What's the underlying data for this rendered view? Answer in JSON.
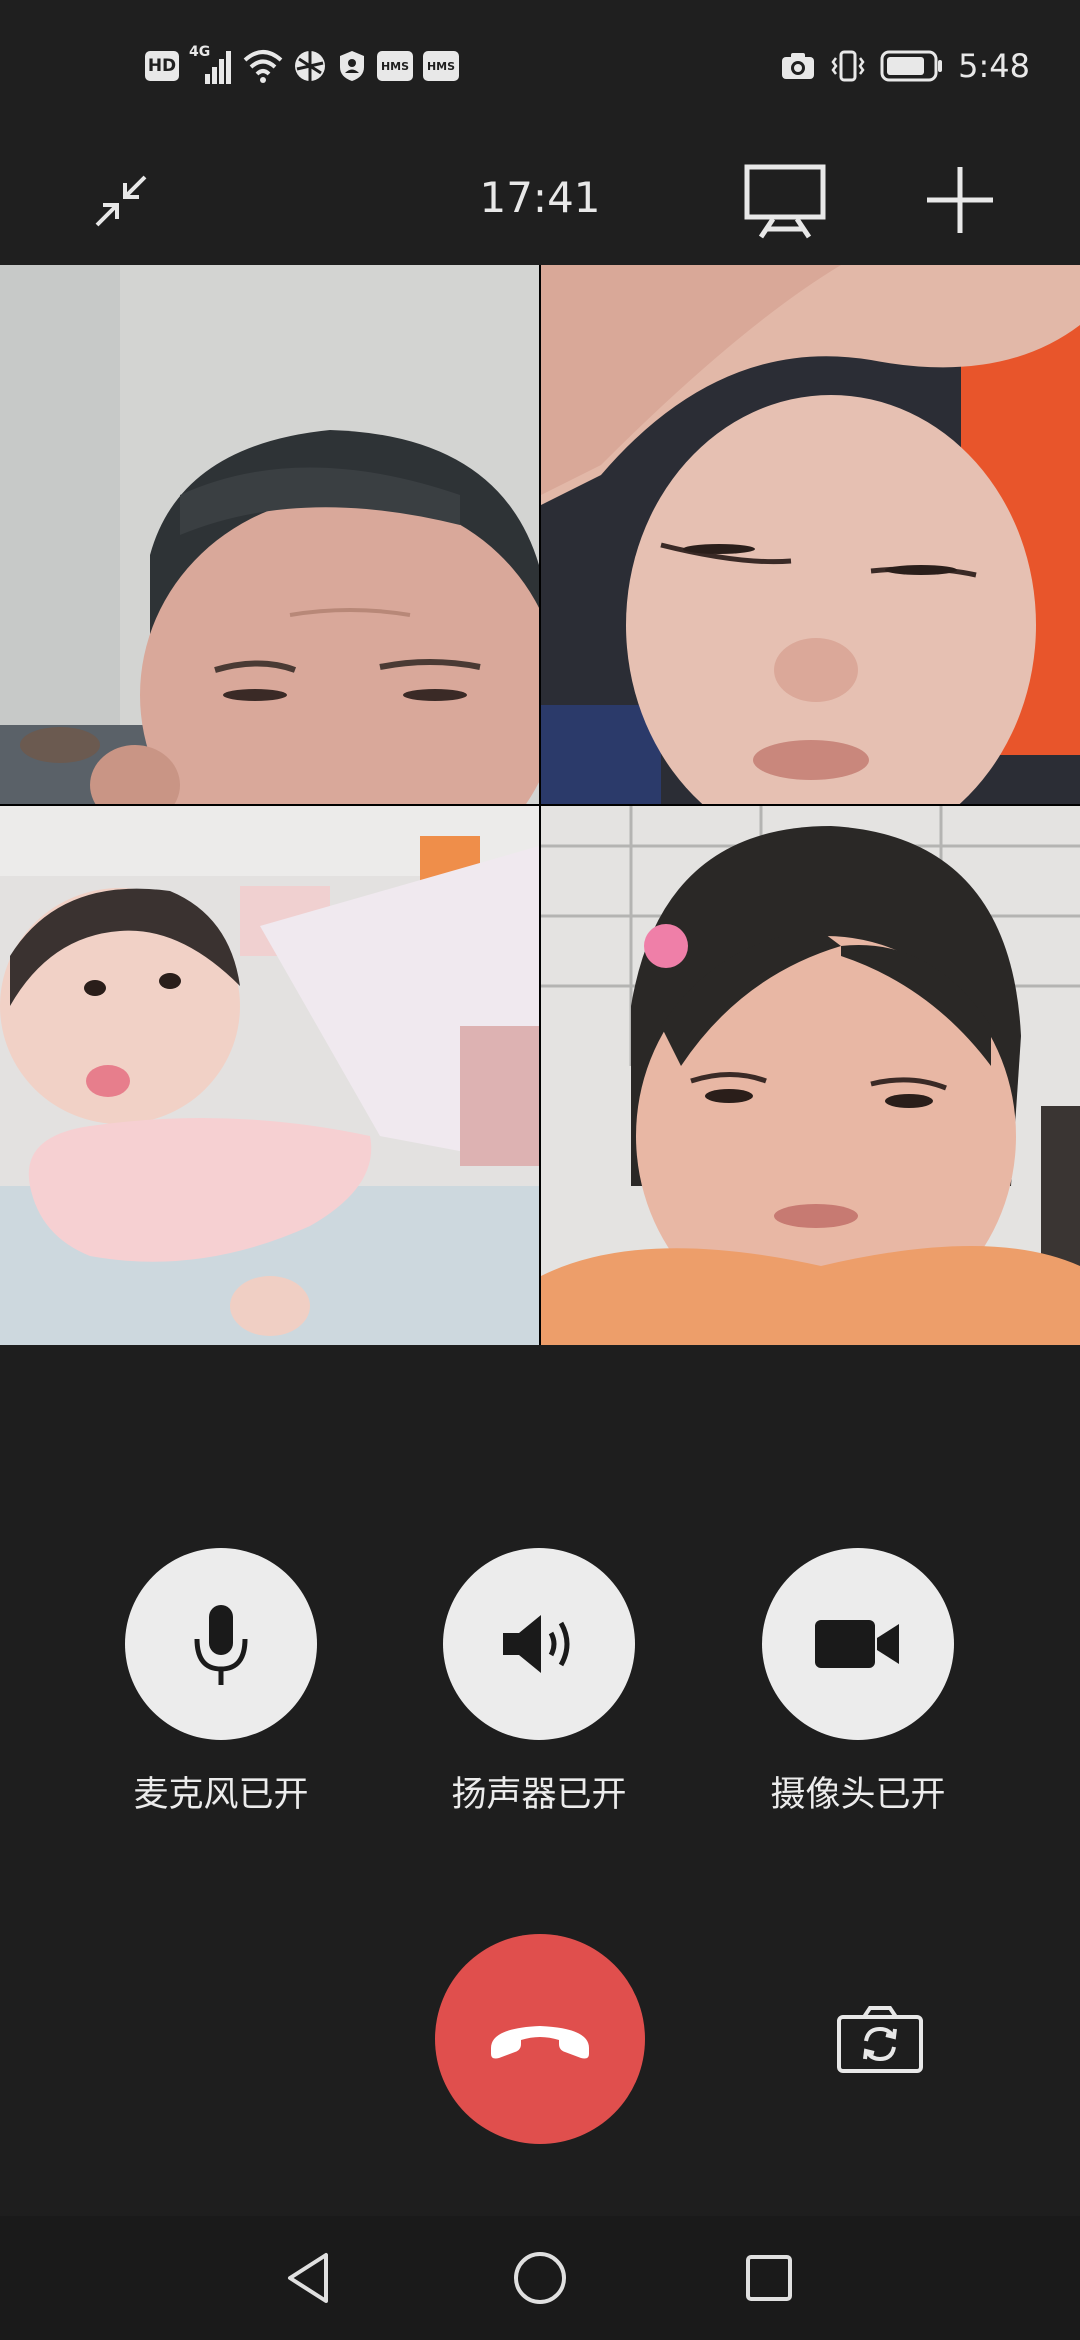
{
  "status_bar": {
    "left_badges": {
      "hd": "HD",
      "network": "4G",
      "hms_1": "HMS",
      "hms_2": "HMS"
    },
    "icons": [
      "hd-icon",
      "signal-4g-icon",
      "wifi-icon",
      "vpn-globe-icon",
      "shield-icon",
      "hms-icon",
      "hms-icon",
      "camera-icon",
      "vibrate-icon",
      "battery-icon"
    ],
    "time": "5:48",
    "battery_level": 0.7
  },
  "call_header": {
    "duration": "17:41",
    "icons": [
      "minimize-icon",
      "screen-share-icon",
      "add-participant-icon"
    ]
  },
  "video_grid": {
    "tiles": [
      "participant-video-1",
      "participant-video-2",
      "participant-video-3",
      "participant-video-4"
    ]
  },
  "controls": {
    "mic_label": "麦克风已开",
    "speaker_label": "扬声器已开",
    "camera_label": "摄像头已开"
  },
  "colors": {
    "background": "#1e1e1e",
    "control_circle": "#ececec",
    "hangup": "#e04f4d",
    "icon_dark": "#1a1a1a",
    "icon_light": "#e8e8e8"
  },
  "nav_bar": {
    "icons": [
      "back-triangle-icon",
      "home-circle-icon",
      "recents-square-icon"
    ]
  }
}
